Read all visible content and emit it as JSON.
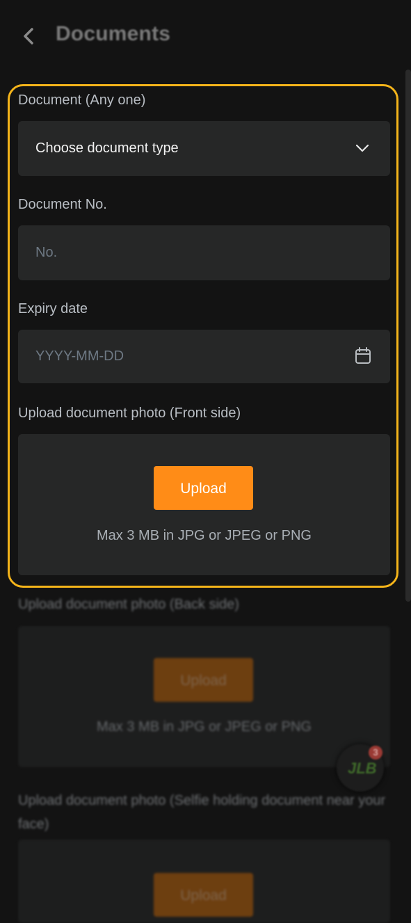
{
  "header": {
    "title": "Documents"
  },
  "form": {
    "document_type": {
      "label": "Document (Any one)",
      "value": "Choose document type"
    },
    "document_no": {
      "label": "Document No.",
      "placeholder": "No."
    },
    "expiry_date": {
      "label": "Expiry date",
      "placeholder": "YYYY-MM-DD"
    },
    "front_upload": {
      "label": "Upload document photo (Front side)",
      "button": "Upload",
      "hint": "Max 3 MB in JPG or JPEG or PNG"
    },
    "back_upload": {
      "label": "Upload document photo (Back side)",
      "button": "Upload",
      "hint": "Max 3 MB in JPG or JPEG or PNG"
    },
    "selfie_upload": {
      "label": "Upload document photo (Selfie holding document near your face)",
      "button": "Upload"
    }
  },
  "chat_widget": {
    "logo_text": "JLB",
    "badge_count": "3"
  },
  "colors": {
    "accent": "#ff8c17",
    "highlight": "#f4b41a",
    "background": "#131313",
    "field": "#262727"
  }
}
